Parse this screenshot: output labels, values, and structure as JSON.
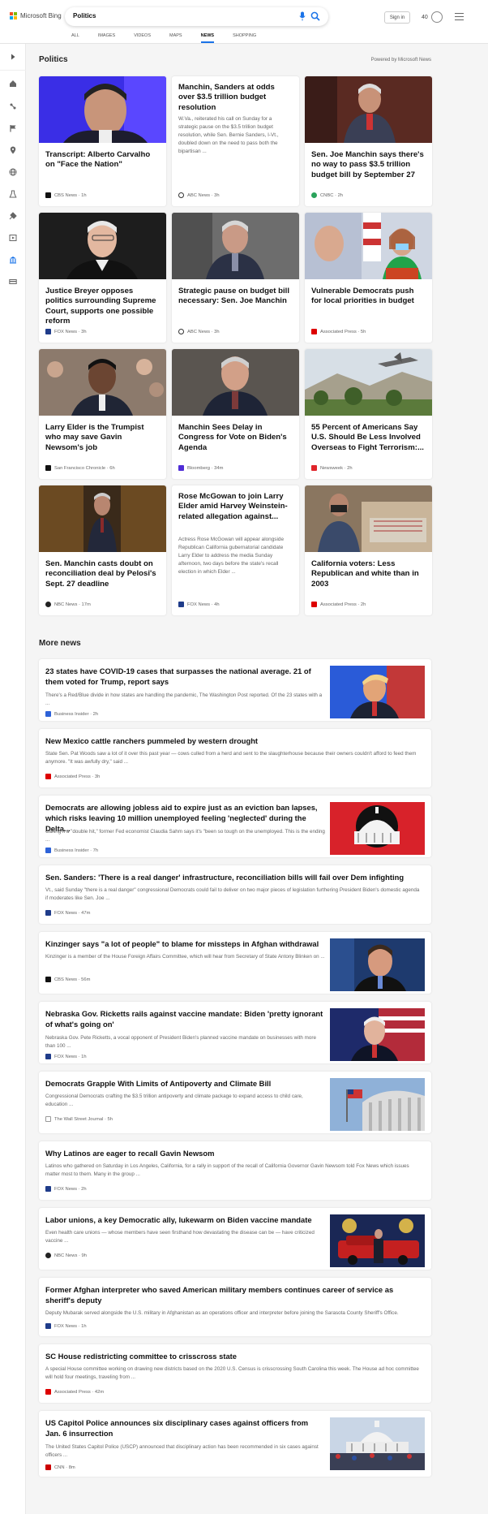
{
  "header": {
    "logo_text": "Microsoft Bing",
    "search_value": "Politics",
    "signin_label": "Sign in",
    "rewards_points": "40",
    "tabs": [
      {
        "label": "ALL"
      },
      {
        "label": "IMAGES"
      },
      {
        "label": "VIDEOS"
      },
      {
        "label": "MAPS"
      },
      {
        "label": "NEWS"
      },
      {
        "label": "SHOPPING"
      }
    ],
    "active_tab": "NEWS"
  },
  "rail_icons": [
    "chevron-right-icon",
    "home-icon",
    "us-news-icon",
    "flag-icon",
    "location-icon",
    "globe-icon",
    "science-icon",
    "technology-icon",
    "entertainment-icon",
    "politics-icon",
    "money-icon"
  ],
  "section": {
    "title": "Politics",
    "powered": "Powered by Microsoft News"
  },
  "cards": [
    {
      "title": "Transcript: Alberto Carvalho on \"Face the Nation\"",
      "source": "CBS News · 1h"
    },
    {
      "title": "Manchin, Sanders at odds over $3.5 trillion budget resolution",
      "desc": "W.Va., reiterated his call on Sunday for a strategic pause on the $3.5 trillion budget resolution, while Sen. Bernie Sanders, I-Vt., doubled down on the need to pass both the bipartisan ...",
      "source": "ABC News · 3h"
    },
    {
      "title": "Sen. Joe Manchin says there's no way to pass $3.5 trillion budget bill by September 27",
      "source": "CNBC · 2h"
    },
    {
      "title": "Justice Breyer opposes politics surrounding Supreme Court, supports one possible reform",
      "source": "FOX News · 3h"
    },
    {
      "title": "Strategic pause on budget bill necessary: Sen. Joe Manchin",
      "source": "ABC News · 3h"
    },
    {
      "title": "Vulnerable Democrats push for local priorities in budget",
      "source": "Associated Press · 5h"
    },
    {
      "title": "Larry Elder is the Trumpist who may save Gavin Newsom's job",
      "source": "San Francisco Chronicle · 6h"
    },
    {
      "title": "Manchin Sees Delay in Congress for Vote on Biden's Agenda",
      "source": "Bloomberg · 34m"
    },
    {
      "title": "55 Percent of Americans Say U.S. Should Be Less Involved Overseas to Fight Terrorism:...",
      "source": "Newsweek · 2h"
    },
    {
      "title": "Sen. Manchin casts doubt on reconciliation deal by Pelosi's Sept. 27 deadline",
      "source": "NBC News · 17m"
    },
    {
      "title": "Rose McGowan to join Larry Elder amid Harvey Weinstein-related allegation against...",
      "desc": "Actress Rose McGowan will appear alongside Republican California gubernatorial candidate Larry Elder to address the media Sunday afternoon, two days before the state's recall election in which Elder ...",
      "source": "FOX News · 4h"
    },
    {
      "title": "California voters: Less Republican and white than in 2003",
      "source": "Associated Press · 2h"
    }
  ],
  "more_news": {
    "title": "More news",
    "items": [
      {
        "title": "23 states have COVID-19 cases that surpasses the national average. 21 of them voted for Trump, report says",
        "desc": "There's a Red/Blue divide in how states are handling the pandemic, The Washington Post reported. Of the 23 states with a ...",
        "source": "Business Insider · 2h"
      },
      {
        "title": "New Mexico cattle ranchers pummeled by western drought",
        "desc": "State Sen. Pat Woods saw a lot of it over this past year — cows culled from a herd and sent to the slaughterhouse because their owners couldn't afford to feed them anymore. \"It was awfully dry,\" said ...",
        "source": "Associated Press · 3h"
      },
      {
        "title": "Democrats are allowing jobless aid to expire just as an eviction ban lapses, which risks leaving 10 million unemployed feeling 'neglected' during the Delta...",
        "desc": "Calling it a \"double hit,\" former Fed economist Claudia Sahm says it's \"been so tough on the unemployed. This is the ending ...",
        "source": "Business Insider · 7h"
      },
      {
        "title": "Sen. Sanders: 'There is a real danger' infrastructure, reconciliation bills will fail over Dem infighting",
        "desc": "Vt., said Sunday \"there is a real danger\" congressional Democrats could fail to deliver on two major pieces of legislation furthering President Biden's domestic agenda if moderates like Sen. Joe ...",
        "source": "FOX News · 47m"
      },
      {
        "title": "Kinzinger says \"a lot of people\" to blame for missteps in Afghan withdrawal",
        "desc": "Kinzinger is a member of the House Foreign Affairs Committee, which will hear from Secretary of State Antony Blinken on ...",
        "source": "CBS News · 56m"
      },
      {
        "title": "Nebraska Gov. Ricketts rails against vaccine mandate: Biden 'pretty ignorant of what's going on'",
        "desc": "Nebraska Gov. Pete Ricketts, a vocal opponent of President Biden's planned vaccine mandate on businesses with more than 100 ...",
        "source": "FOX News · 1h"
      },
      {
        "title": "Democrats Grapple With Limits of Antipoverty and Climate Bill",
        "desc": "Congressional Democrats crafting the $3.5 trillion antipoverty and climate package to expand access to child care, education ...",
        "source": "The Wall Street Journal · 5h"
      },
      {
        "title": "Why Latinos are eager to recall Gavin Newsom",
        "desc": "Latinos who gathered on Saturday in Los Angeles, California, for a rally in support of the recall of California Governor Gavin Newsom told Fox News which issues matter most to them. Many in the group ...",
        "source": "FOX News · 2h"
      },
      {
        "title": "Labor unions, a key Democratic ally, lukewarm on Biden vaccine mandate",
        "desc": "Even health care unions — whose members have seen firsthand how devastating the disease can be — have criticized vaccine ...",
        "source": "NBC News · 9h"
      },
      {
        "title": "Former Afghan interpreter who saved American military members continues career of service as sheriff's deputy",
        "desc": "Deputy Mubarak served alongside the U.S. military in Afghanistan as an operations officer and interpreter before joining the Sarasota County Sheriff's Office.",
        "source": "FOX News · 1h"
      },
      {
        "title": "SC House redistricting committee to crisscross state",
        "desc": "A special House committee working on drawing new districts based on the 2020 U.S. Census is crisscrossing South Carolina this week. The House ad hoc committee will hold four meetings, traveling from ...",
        "source": "Associated Press · 42m"
      },
      {
        "title": "US Capitol Police announces six disciplinary cases against officers from Jan. 6 insurrection",
        "desc": "The United States Capitol Police (USCP) announced that disciplinary action has been recommended in six cases against officers ...",
        "source": "CNN · 8m"
      }
    ]
  },
  "colors": {
    "accent": "#1a73e8"
  }
}
